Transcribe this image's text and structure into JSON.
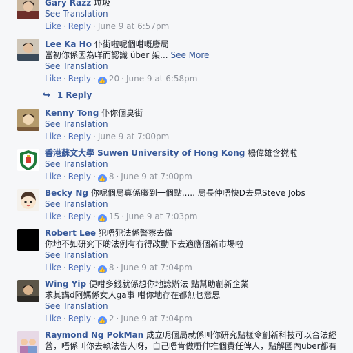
{
  "comments": [
    {
      "name": "Gary Razz",
      "text": "垃圾",
      "see_translation": "See Translation",
      "like": "Like",
      "reply": "Reply",
      "time": "June 9 at 6:57pm",
      "avatar": "photo-avatar"
    },
    {
      "name": "Lee Ka Ho",
      "text": "仆街啦呢個咁嘅廢局",
      "text2": "當初你係因為咩而認識 über 架...",
      "see_more": "See More",
      "see_translation": "See Translation",
      "like": "Like",
      "reply": "Reply",
      "reactions": "20",
      "time": "June 9 at 6:58pm",
      "reply_count": "1 Reply",
      "avatar": "photo-avatar"
    },
    {
      "name": "Kenny Tong",
      "text": "仆你個臭街",
      "see_translation": "See Translation",
      "like": "Like",
      "reply": "Reply",
      "time": "June 9 at 7:00pm",
      "avatar": "photo-avatar"
    },
    {
      "name": "香港蘇文大學 Suwen University of Hong Kong",
      "text": "楊偉雄含撚啦",
      "see_translation": "See Translation",
      "like": "Like",
      "reply": "Reply",
      "reactions": "8",
      "time": "June 9 at 7:00pm",
      "avatar": "university-logo-avatar"
    },
    {
      "name": "Becky Ng",
      "text": "你呢個局真係廢到一個點..... 局長仲唔快D去見Steve Jobs",
      "see_translation": "See Translation",
      "like": "Like",
      "reply": "Reply",
      "reactions": "15",
      "time": "June 9 at 7:03pm",
      "avatar": "cartoon-avatar"
    },
    {
      "name": "Robert Lee",
      "text": "犯唔犯法係警察去做",
      "text2": "你地不如研究下啲法例有冇得改動下去適應個新市場啦",
      "see_translation": "See Translation",
      "like": "Like",
      "reply": "Reply",
      "reactions": "8",
      "time": "June 9 at 7:04pm",
      "avatar": "black-avatar"
    },
    {
      "name": "Wing Yip",
      "text": "便咁多錢就係想你地諗辦法 點幫助創新企業",
      "text2": "求其講d阿媽係女人ga事 咁你地存在都無乜意思",
      "see_translation": "See Translation",
      "like": "Like",
      "reply": "Reply",
      "reactions": "2",
      "time": "June 9 at 7:04pm",
      "avatar": "photo-avatar"
    },
    {
      "name": "Raymond Ng PokMan",
      "text": "成立呢個局就係叫你研究點樣令創新科技可以合法經",
      "text2": "營，唔係叫你去執法告人呀，自己唔肯做嘢伸推個責任俾人，點解國內uber都有",
      "avatar": "photo-avatar"
    }
  ],
  "icons": {
    "like_bubble": "thumbs-up-icon",
    "reply_arrow": "reply-arrow-icon"
  },
  "colors": {
    "name": "#365899",
    "link": "#4b6cb7",
    "meta": "#90949c",
    "like_bubble": "#5890ff",
    "background": "#f6f7f9"
  }
}
